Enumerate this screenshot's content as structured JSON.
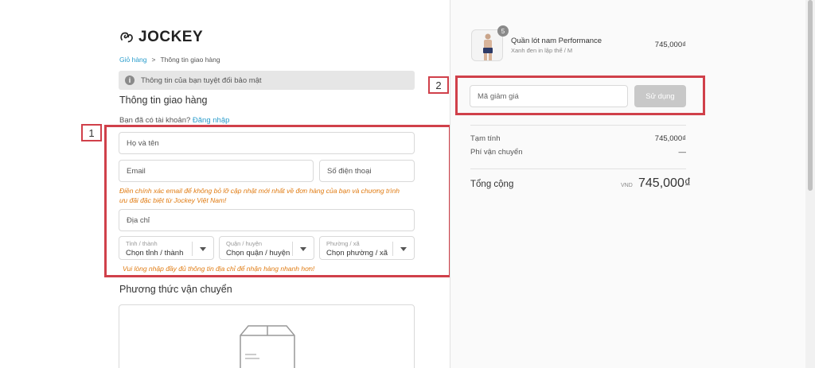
{
  "brand": {
    "name": "JOCKEY"
  },
  "breadcrumb": {
    "cart": "Giỏ hàng",
    "separator": ">",
    "current": "Thông tin giao hàng"
  },
  "notice": {
    "text": "Thông tin của bạn tuyệt đối bảo mật",
    "icon": "info-icon"
  },
  "shipping_info": {
    "title": "Thông tin giao hàng",
    "account_prompt": "Bạn đã có tài khoản?",
    "login_link": "Đăng nhập",
    "fields": {
      "full_name_placeholder": "Họ và tên",
      "email_placeholder": "Email",
      "phone_placeholder": "Số điện thoại",
      "address_placeholder": "Địa chỉ"
    },
    "email_hint_line1": "Điền chính xác email để không bỏ lỡ cập nhật mới nhất về đơn hàng của bạn và chương trình",
    "email_hint_line2": "ưu đãi đặc biệt từ Jockey Việt Nam!",
    "selects": [
      {
        "label": "Tỉnh / thành",
        "value": "Chọn tỉnh / thành"
      },
      {
        "label": "Quận / huyện",
        "value": "Chọn quận / huyện"
      },
      {
        "label": "Phường / xã",
        "value": "Chọn phường / xã"
      }
    ],
    "address_hint": "Vui lòng nhập đầy đủ thông tin địa chỉ để nhận hàng nhanh hơn!"
  },
  "shipping_method": {
    "title": "Phương thức vận chuyển"
  },
  "annotations": {
    "marker1": "1",
    "marker2": "2",
    "color": "#d0404a"
  },
  "order": {
    "item": {
      "quantity": "5",
      "name": "Quần lót nam Performance",
      "variant": "Xanh đen in lập thể / M",
      "price": "745,000₫"
    },
    "discount": {
      "placeholder": "Mã giảm giá",
      "apply_label": "Sử dụng"
    },
    "subtotal_label": "Tạm tính",
    "subtotal_value": "745,000₫",
    "shipping_label": "Phí vận chuyển",
    "shipping_value": "—",
    "total_label": "Tổng cộng",
    "total_currency": "VND",
    "total_value": "745,000₫"
  },
  "colors": {
    "link": "#2a9dcc",
    "hint": "#e07b12",
    "highlight": "#d0404a",
    "button_disabled": "#c8c8c8"
  }
}
